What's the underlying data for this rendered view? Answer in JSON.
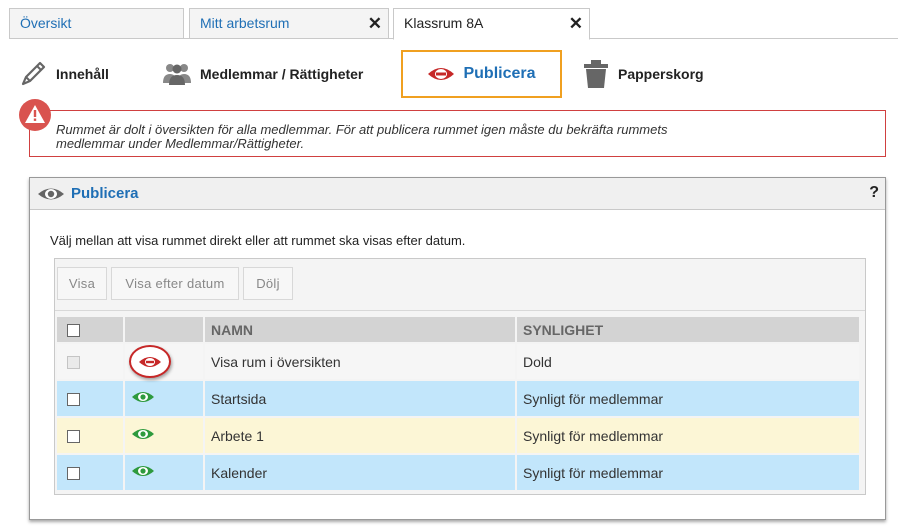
{
  "tabs": [
    {
      "label": "Översikt",
      "active": false,
      "closable": false
    },
    {
      "label": "Mitt arbetsrum",
      "active": false,
      "closable": true
    },
    {
      "label": "Klassrum 8A",
      "active": true,
      "closable": true
    }
  ],
  "tab_close_glyph": "✕",
  "actions": [
    {
      "label": "Innehåll",
      "icon": "pencil-icon"
    },
    {
      "label": "Medlemmar / Rättigheter",
      "icon": "members-icon"
    },
    {
      "label": "Publicera",
      "icon": "hidden-eye-icon",
      "selected": true
    },
    {
      "label": "Papperskorg",
      "icon": "trash-icon"
    }
  ],
  "warning": {
    "text": "Rummet är dolt i översikten för alla medlemmar. För att publicera rummet igen måste du bekräfta rummets medlemmar under Medlemmar/Rättigheter.",
    "icon": "warning-icon"
  },
  "panel": {
    "title": "Publicera",
    "help": "?",
    "description": "Välj mellan att visa rummet direkt eller att rummet ska visas efter datum.",
    "segments": [
      "Visa",
      "Visa efter datum",
      "Dölj"
    ],
    "columns": {
      "name": "NAMN",
      "visibility": "SYNLIGHET"
    },
    "rows": [
      {
        "name": "Visa rum i översikten",
        "visibility": "Dold",
        "state": "hidden"
      },
      {
        "name": "Startsida",
        "visibility": "Synligt för medlemmar",
        "state": "visible"
      },
      {
        "name": "Arbete 1",
        "visibility": "Synligt för medlemmar",
        "state": "visible"
      },
      {
        "name": "Kalender",
        "visibility": "Synligt för medlemmar",
        "state": "visible"
      }
    ]
  },
  "colors": {
    "accent": "#1f6fb5",
    "selected_border": "#f0a020",
    "warning": "#d04040",
    "visible_eye": "#2e9a3e",
    "hidden_eye": "#c62828"
  }
}
